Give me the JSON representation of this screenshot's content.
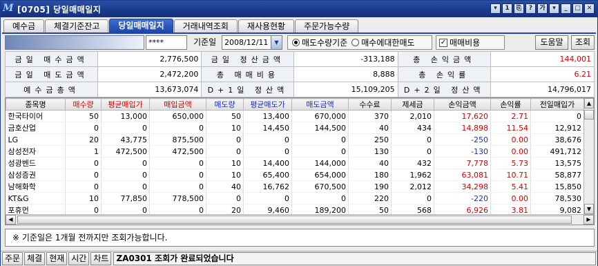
{
  "window": {
    "screen_no": "[0705]",
    "title": "당일매매일지",
    "title_buttons": [
      "▾",
      "1",
      "⎘",
      "?",
      "가",
      "▾",
      "_",
      "□",
      "✕"
    ]
  },
  "tabs": [
    {
      "label": "예수금",
      "active": false
    },
    {
      "label": "체결기준잔고",
      "active": false
    },
    {
      "label": "당일매매일지",
      "active": true
    },
    {
      "label": "거래내역조회",
      "active": false
    },
    {
      "label": "재사용현황",
      "active": false
    },
    {
      "label": "주문가능수량",
      "active": false
    }
  ],
  "controls": {
    "password_mask": "****",
    "date_label": "기준일",
    "date_value": "2008/12/11",
    "radio_sell_qty": "매도수량기준",
    "radio_buy_vs_sell": "매수에대한매도",
    "checkbox_fee": "매매비용",
    "help_button": "도움말",
    "query_button": "조회"
  },
  "summary": [
    [
      {
        "k": "금일 매수금액",
        "v": "2,776,500"
      },
      {
        "k": "금일 정산금액",
        "v": "-313,188"
      },
      {
        "k": "총 손익금액",
        "v": "144,001",
        "red": true
      }
    ],
    [
      {
        "k": "금일 매도금액",
        "v": "2,472,200"
      },
      {
        "k": "총 매매비용",
        "v": "8,888"
      },
      {
        "k": "총 손익률",
        "v": "6.21",
        "red": true
      }
    ],
    [
      {
        "k": "예수금총액",
        "v": "13,673,074"
      },
      {
        "k": "D+1일 정산액",
        "v": "15,109,205"
      },
      {
        "k": "D+2일 정산액",
        "v": "14,796,017"
      }
    ]
  ],
  "grid": {
    "columns": [
      {
        "label": "종목명",
        "color": ""
      },
      {
        "label": "매수량",
        "color": "red"
      },
      {
        "label": "평균매입가",
        "color": "red"
      },
      {
        "label": "매입금액",
        "color": "red"
      },
      {
        "label": "매도량",
        "color": "blue"
      },
      {
        "label": "평균매도가",
        "color": "blue"
      },
      {
        "label": "매도금액",
        "color": "blue"
      },
      {
        "label": "수수료",
        "color": ""
      },
      {
        "label": "제세금",
        "color": ""
      },
      {
        "label": "손익금액",
        "color": ""
      },
      {
        "label": "손익률",
        "color": ""
      },
      {
        "label": "전일매입가",
        "color": ""
      }
    ],
    "rows": [
      [
        "한국타이어",
        "50",
        "13,000",
        "650,000",
        "50",
        "13,400",
        "670,000",
        "370",
        "2,010",
        "17,620",
        "2.71",
        "0"
      ],
      [
        "금호산업",
        "0",
        "0",
        "0",
        "10",
        "14,450",
        "144,500",
        "40",
        "434",
        "14,898",
        "11.54",
        "12,912"
      ],
      [
        "LG",
        "20",
        "43,775",
        "875,500",
        "0",
        "0",
        "0",
        "250",
        "0",
        "-250",
        "0.00",
        "38,676"
      ],
      [
        "삼성전자",
        "1",
        "472,500",
        "472,500",
        "0",
        "0",
        "0",
        "130",
        "0",
        "-130",
        "0.00",
        "491,712"
      ],
      [
        "성광벤드",
        "0",
        "0",
        "0",
        "10",
        "14,400",
        "144,000",
        "40",
        "432",
        "7,778",
        "5.73",
        "13,575"
      ],
      [
        "삼성증권",
        "0",
        "0",
        "0",
        "10",
        "65,400",
        "654,000",
        "180",
        "1,962",
        "63,081",
        "10.71",
        "58,877"
      ],
      [
        "남해화학",
        "0",
        "0",
        "0",
        "40",
        "16,762",
        "670,500",
        "190",
        "2,012",
        "34,298",
        "5.41",
        "15,850"
      ],
      [
        "KT&G",
        "10",
        "77,850",
        "778,500",
        "0",
        "0",
        "0",
        "220",
        "0",
        "-220",
        "0.00",
        "78,530"
      ],
      [
        "포휴먼",
        "0",
        "0",
        "0",
        "20",
        "9,460",
        "189,200",
        "50",
        "568",
        "6,926",
        "3.81",
        "9,082"
      ]
    ]
  },
  "notice": "※ 기준일은 1개월 전까지만 조회가능합니다.",
  "statusbar": {
    "buttons": [
      "주문",
      "체결",
      "현재",
      "시간",
      "차트"
    ],
    "message": "ZA0301 조회가 완료되었습니다"
  }
}
